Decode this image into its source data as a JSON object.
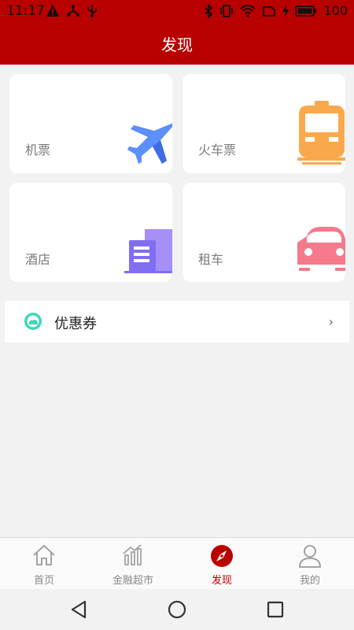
{
  "status_bar": {
    "time": "11:17",
    "battery": "100"
  },
  "header": {
    "title": "发现"
  },
  "cards": [
    {
      "label": "机票",
      "icon": "airplane-icon",
      "color": "#5b8ff9"
    },
    {
      "label": "火车票",
      "icon": "train-icon",
      "color": "#f9a94b"
    },
    {
      "label": "酒店",
      "icon": "hotel-building-icon",
      "color": "#8f7ff5"
    },
    {
      "label": "租车",
      "icon": "car-icon",
      "color": "#f47a8c"
    }
  ],
  "coupon": {
    "label": "优惠券",
    "icon": "coupon-icon",
    "chevron": "›"
  },
  "bottom_nav": {
    "items": [
      {
        "label": "首页",
        "icon": "home-icon"
      },
      {
        "label": "金融超市",
        "icon": "chart-icon"
      },
      {
        "label": "发现",
        "icon": "compass-icon",
        "active": true
      },
      {
        "label": "我的",
        "icon": "user-icon"
      }
    ]
  },
  "colors": {
    "brand": "#b90000",
    "background": "#f2f2f2"
  }
}
